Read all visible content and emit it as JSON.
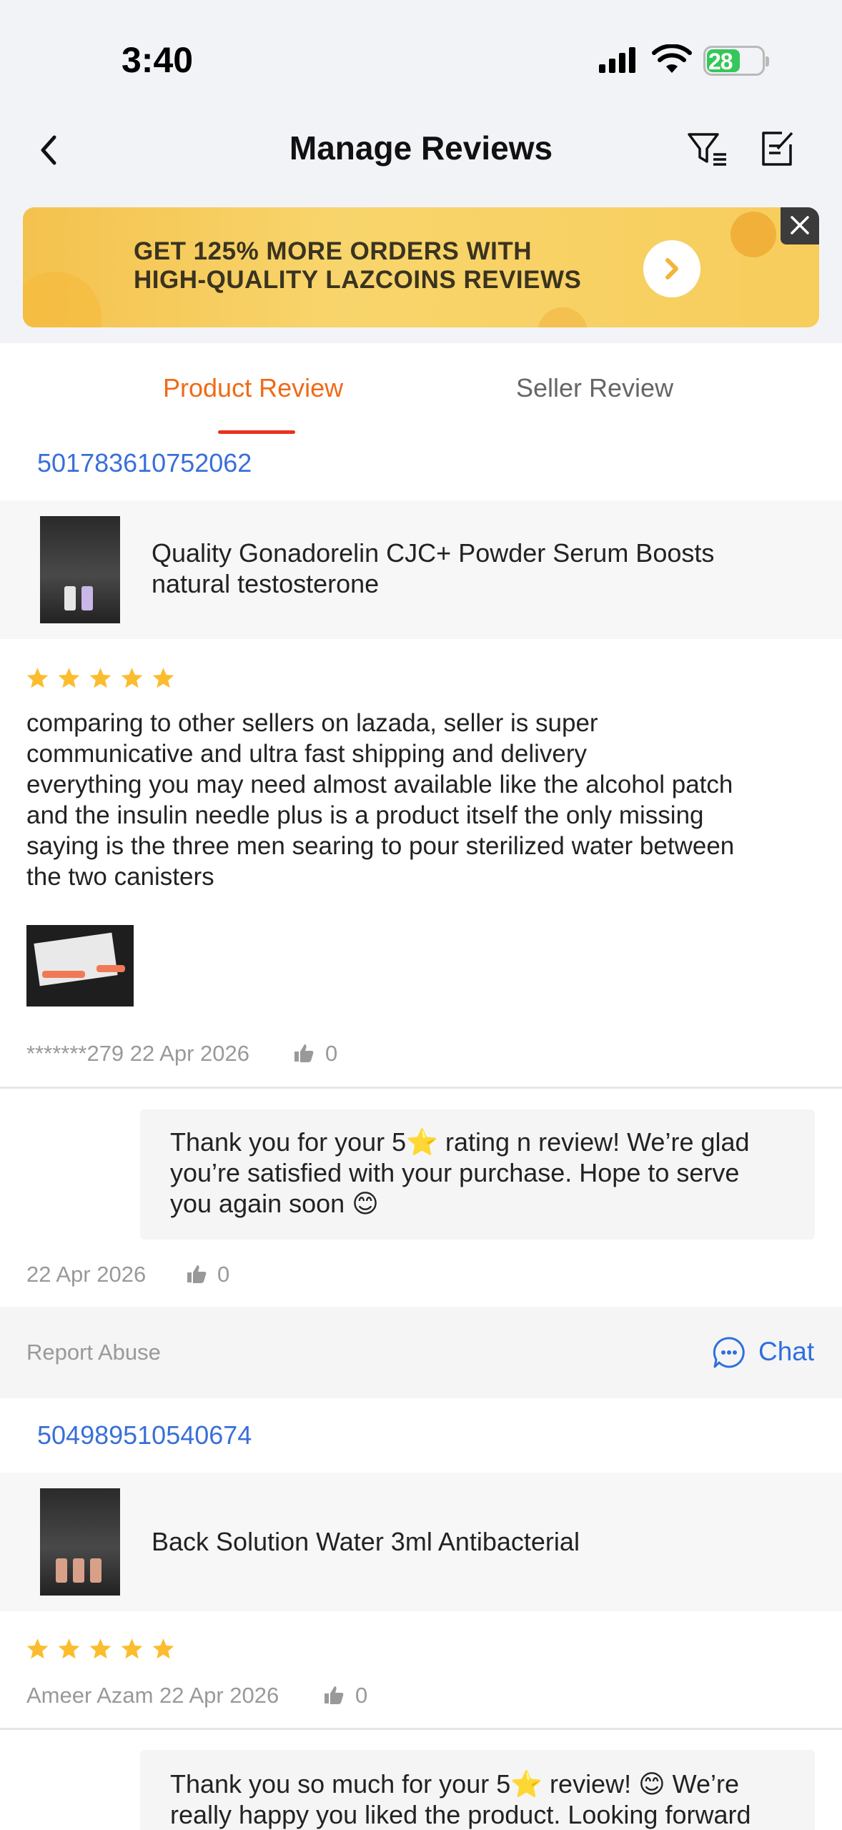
{
  "status_bar": {
    "time": "3:40",
    "battery": "28"
  },
  "header": {
    "title": "Manage Reviews"
  },
  "banner": {
    "line1": "GET 125% MORE ORDERS WITH",
    "line2": "HIGH-QUALITY LAZCOINS REVIEWS"
  },
  "tabs": [
    {
      "label": "Product Review",
      "active": true
    },
    {
      "label": "Seller Review",
      "active": false
    }
  ],
  "reviews": [
    {
      "order_id": "501783610752062",
      "product_name_line1": "Quality Gonadorelin  CJC+ Powder Serum Boosts",
      "product_name_line2": "natural testosterone",
      "rating": 5,
      "text_lines": [
        "comparing to other sellers on lazada, seller is super",
        "communicative and ultra fast shipping and delivery",
        "everything you may need almost available like the alcohol patch",
        "and the insulin needle plus is a product itself the only missing",
        "saying is the three men searing to pour sterilized water between",
        "the two canisters"
      ],
      "reviewer_date": "*******279 22 Apr 2026",
      "likes": "0",
      "reply": {
        "lines": [
          "Thank you for your 5⭐ rating n review! We’re glad",
          "you’re satisfied with your purchase. Hope to serve",
          "you again soon 😊"
        ],
        "date": "22 Apr 2026",
        "likes": "0"
      },
      "actions": {
        "report_label": "Report Abuse",
        "chat_label": "Chat"
      }
    },
    {
      "order_id": "504989510540674",
      "product_name_line1": "Back Solution Water 3ml Antibacterial",
      "rating": 5,
      "reviewer_date": "Ameer Azam 22 Apr 2026",
      "likes": "0",
      "reply": {
        "lines": [
          "Thank you so much for your 5⭐ review! 😊 We’re",
          "really happy you liked the product. Looking forward"
        ]
      }
    }
  ],
  "colors": {
    "accent_orange": "#f06a17",
    "tab_indicator": "#e8321f",
    "link_blue": "#3a6fd8",
    "star": "#fbbd2e"
  }
}
